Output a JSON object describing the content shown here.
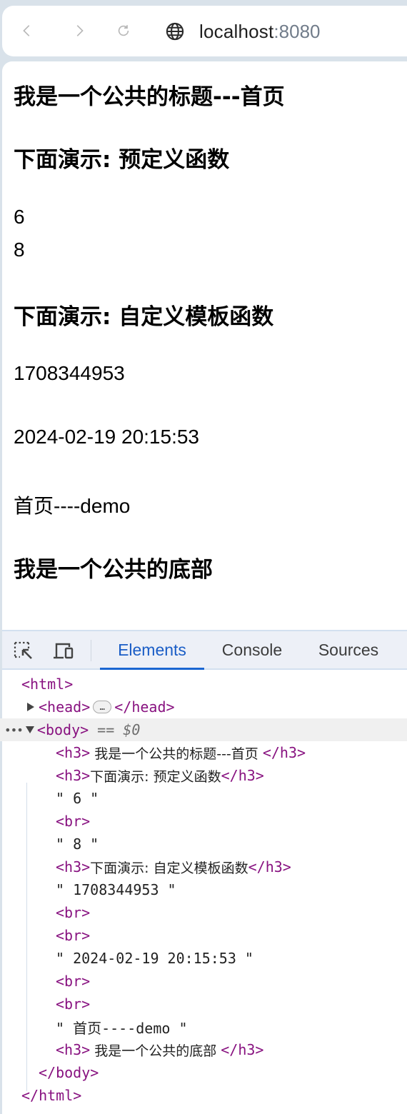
{
  "browser": {
    "nav": {
      "back_icon": "chevron-left-icon",
      "forward_icon": "chevron-right-icon",
      "reload_icon": "reload-icon"
    },
    "url": {
      "site_icon": "globe-icon",
      "host": "localhost",
      "port": ":8080"
    }
  },
  "page": {
    "header_title": "我是一个公共的标题---首页",
    "section1_title": "下面演示: 预定义函数",
    "value_1": "6",
    "value_2": "8",
    "section2_title": "下面演示: 自定义模板函数",
    "timestamp": "1708344953",
    "datetime": "2024-02-19 20:15:53",
    "page_name": "首页----demo",
    "footer_title": "我是一个公共的底部"
  },
  "devtools": {
    "tools": {
      "inspect_icon": "inspect-element-icon",
      "device_icon": "device-toolbar-icon"
    },
    "tabs": [
      {
        "label": "Elements",
        "active": true
      },
      {
        "label": "Console",
        "active": false
      },
      {
        "label": "Sources",
        "active": false
      }
    ],
    "tree": {
      "html_open": "<html>",
      "head_open": "<head>",
      "head_ellipsis": "…",
      "head_close": "</head>",
      "body_open": "<body>",
      "body_selected_marker": "== $0",
      "h3_open": "<h3>",
      "h3_close": "</h3>",
      "br": "<br>",
      "body_close": "</body>",
      "html_close": "</html>",
      "h3_1_text": " 我是一个公共的标题---首页 ",
      "h3_2_text": "下面演示: 预定义函数",
      "text_6": "\" 6 \"",
      "text_8": "\" 8 \"",
      "h3_3_text": "下面演示: 自定义模板函数",
      "text_timestamp": "\" 1708344953 \"",
      "text_datetime": "\" 2024-02-19 20:15:53 \"",
      "text_pagename": "\" 首页----demo \"",
      "h3_4_text": " 我是一个公共的底部 "
    }
  }
}
